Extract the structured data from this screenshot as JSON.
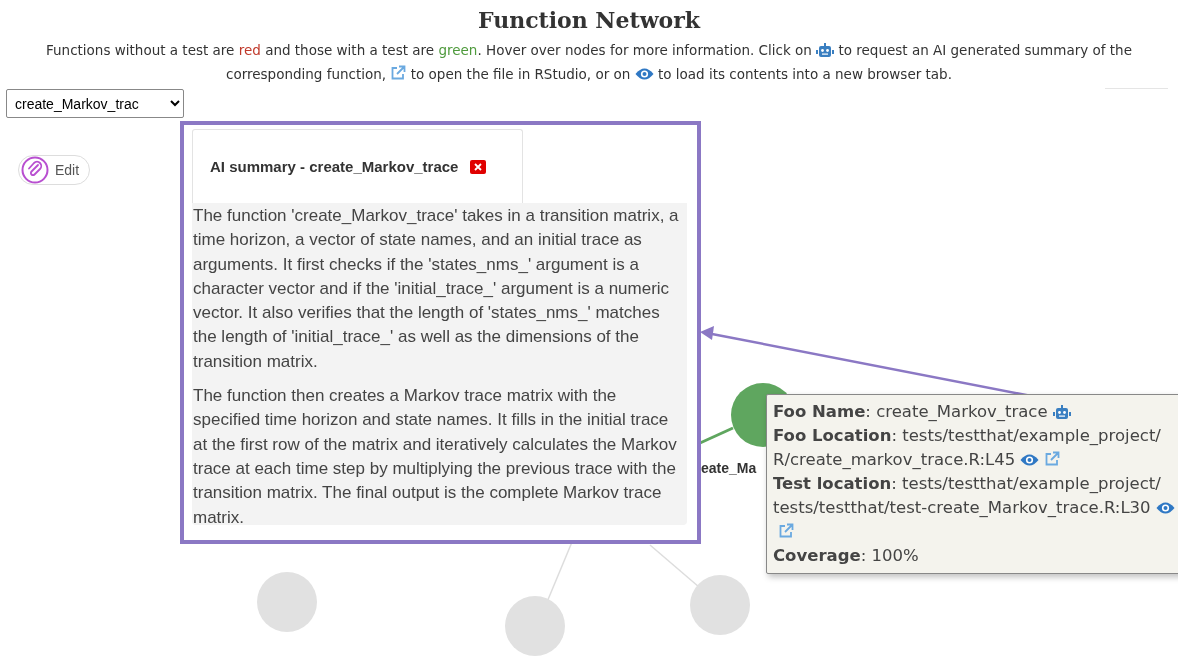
{
  "title": "Function Network",
  "intro": [
    {
      "kind": "text",
      "text": "Functions without a test are "
    },
    {
      "kind": "colored",
      "text": "red",
      "color": "#c0392b"
    },
    {
      "kind": "text",
      "text": " and those with a test are "
    },
    {
      "kind": "colored",
      "text": "green",
      "color": "#4e9a3c"
    },
    {
      "kind": "text",
      "text": ". Hover over nodes for more information. Click on "
    },
    {
      "kind": "robot"
    },
    {
      "kind": "text",
      "text": " to request an AI generated summary of the corresponding function, "
    },
    {
      "kind": "open"
    },
    {
      "kind": "text",
      "text": " to open the file in RStudio, or on "
    },
    {
      "kind": "view"
    },
    {
      "kind": "text",
      "text": " to load its contents into a new browser tab."
    }
  ],
  "function_select": {
    "value": "create_Markov_trac"
  },
  "edit_button": {
    "label": "Edit"
  },
  "network": {
    "nodes": [
      {
        "kind": "tested",
        "label": "eate_Ma"
      },
      {
        "kind": "dimmed"
      },
      {
        "kind": "dimmed"
      },
      {
        "kind": "dimmed"
      }
    ]
  },
  "summary_panel": {
    "title": "AI summary - create_Markov_trace",
    "paragraphs": [
      "The function 'create_Markov_trace' takes in a transition matrix, a time horizon, a vector of state names, and an initial trace as arguments. It first checks if the 'states_nms_' argument is a character vector and if the 'initial_trace_' argument is a numeric vector. It also verifies that the length of 'states_nms_' matches the length of 'initial_trace_' as well as the dimensions of the transition matrix.",
      "The function then creates a Markov trace matrix with the specified time horizon and state names. It fills in the initial trace at the first row of the matrix and iteratively calculates the Markov trace at each time step by multiplying the previous trace with the transition matrix. The final output is the complete Markov trace matrix."
    ]
  },
  "tooltip": {
    "rows": [
      {
        "lines": [
          "**Foo Name**: create_Markov_trace"
        ],
        "has_summary": true
      },
      {
        "lines": [
          "**Foo Location**: tests/testthat/example_project/",
          "R/create_markov_trace.R:L45"
        ],
        "has_view": true,
        "has_open": true
      },
      {
        "lines": [
          "**Test location**: tests/testthat/example_project/",
          "tests/testthat/test-create_Markov_trace.R:L30"
        ],
        "has_view": true,
        "has_open": true
      },
      {
        "lines": [
          "**Coverage**: 100%"
        ]
      }
    ]
  }
}
